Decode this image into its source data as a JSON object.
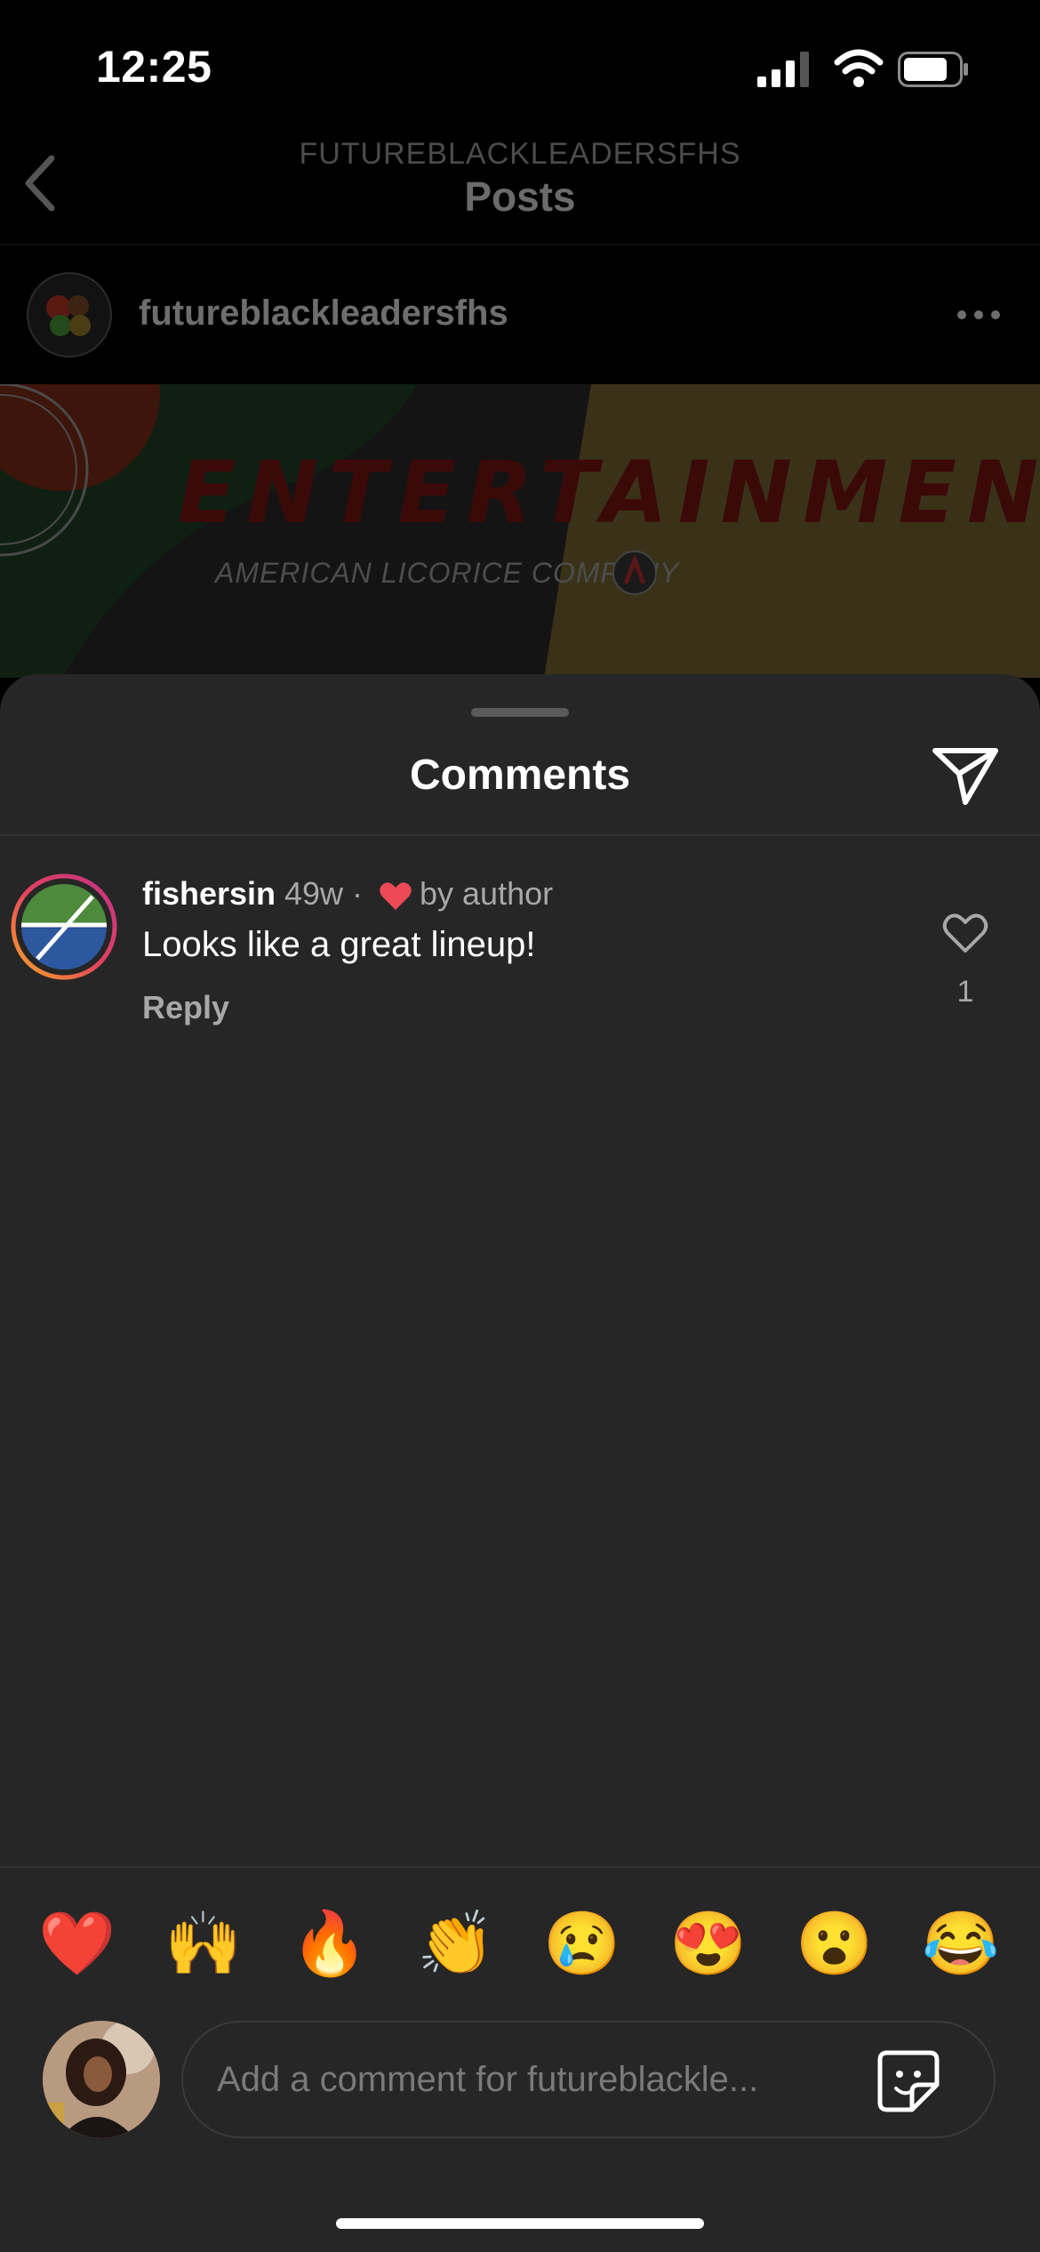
{
  "status_bar": {
    "time": "12:25"
  },
  "header": {
    "account": "FUTUREBLACKLEADERSFHS",
    "title": "Posts"
  },
  "post": {
    "username": "futureblackleadersfhs",
    "image_title": "ENTERTAINMENT",
    "image_sub": "AMERICAN LICORICE COMPANY"
  },
  "comments_sheet": {
    "title": "Comments",
    "items": [
      {
        "username": "fishersin",
        "age": "49w ·",
        "liked_by": "by author",
        "text": "Looks like a great lineup!",
        "reply_label": "Reply",
        "like_count": "1"
      }
    ]
  },
  "emoji_bar": [
    "❤️",
    "🙌",
    "🔥",
    "👏",
    "😢",
    "😍",
    "😮",
    "😂"
  ],
  "composer": {
    "placeholder": "Add a comment for futureblackle..."
  },
  "colors": {
    "sheet_bg": "#262626",
    "like_red": "#ed4956",
    "muted_text": "#a8a8a8"
  }
}
